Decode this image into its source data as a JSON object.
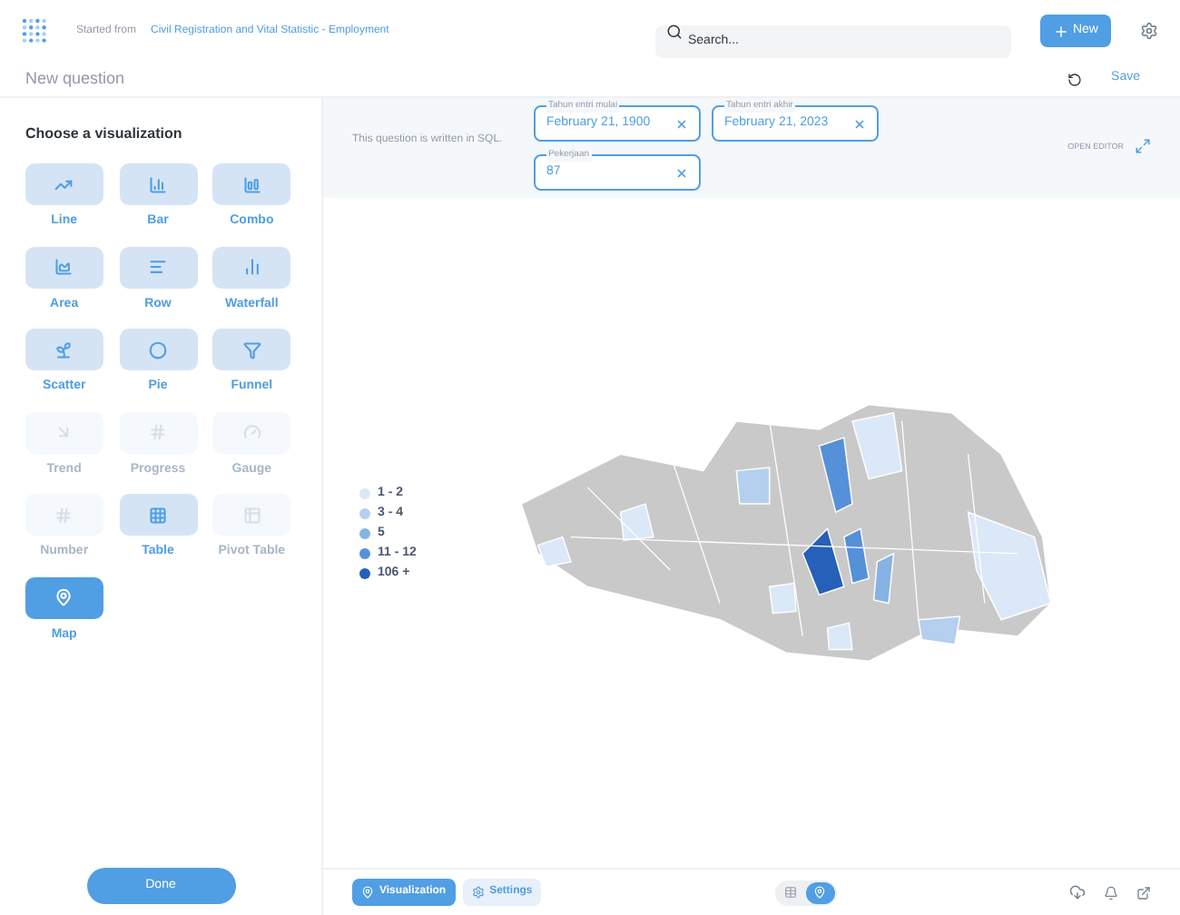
{
  "header": {
    "prefix": "Started from",
    "source": "Civil Registration and Vital Statistic - Employment",
    "search_placeholder": "Search...",
    "new_button": "New"
  },
  "question": {
    "title": "New question",
    "save": "Save"
  },
  "sidebar": {
    "title": "Choose a visualization",
    "done": "Done",
    "items": [
      {
        "kind": "line",
        "label": "Line",
        "selected": false,
        "disabled": false
      },
      {
        "kind": "bar",
        "label": "Bar",
        "selected": false,
        "disabled": false
      },
      {
        "kind": "combo",
        "label": "Combo",
        "selected": false,
        "disabled": false
      },
      {
        "kind": "area",
        "label": "Area",
        "selected": false,
        "disabled": false
      },
      {
        "kind": "row",
        "label": "Row",
        "selected": false,
        "disabled": false
      },
      {
        "kind": "waterfall",
        "label": "Waterfall",
        "selected": false,
        "disabled": false
      },
      {
        "kind": "scatter",
        "label": "Scatter",
        "selected": false,
        "disabled": false
      },
      {
        "kind": "pie",
        "label": "Pie",
        "selected": false,
        "disabled": false
      },
      {
        "kind": "funnel",
        "label": "Funnel",
        "selected": false,
        "disabled": false
      },
      {
        "kind": "trend",
        "label": "Trend",
        "selected": false,
        "disabled": true
      },
      {
        "kind": "progress",
        "label": "Progress",
        "selected": false,
        "disabled": true
      },
      {
        "kind": "gauge",
        "label": "Gauge",
        "selected": false,
        "disabled": true
      },
      {
        "kind": "number",
        "label": "Number",
        "selected": false,
        "disabled": true
      },
      {
        "kind": "table",
        "label": "Table",
        "selected": false,
        "disabled": false
      },
      {
        "kind": "pivot",
        "label": "Pivot Table",
        "selected": false,
        "disabled": true
      },
      {
        "kind": "map",
        "label": "Map",
        "selected": true,
        "disabled": false
      }
    ]
  },
  "filters": {
    "note": "This question is written in SQL.",
    "open_editor": "OPEN EDITOR",
    "items": [
      {
        "label": "Tahun entri mulai",
        "value": "February 21, 1900"
      },
      {
        "label": "Tahun entri akhir",
        "value": "February 21, 2023"
      },
      {
        "label": "Pekerjaan",
        "value": "87"
      }
    ]
  },
  "legend": [
    {
      "label": "1 - 2",
      "color": "#dbe8f7"
    },
    {
      "label": "3 - 4",
      "color": "#b4d0ee"
    },
    {
      "label": "5",
      "color": "#86b3e3"
    },
    {
      "label": "11 - 12",
      "color": "#5591d8"
    },
    {
      "label": "106 +",
      "color": "#2660b8"
    }
  ],
  "footer": {
    "visualization": "Visualization",
    "settings": "Settings",
    "view": [
      {
        "kind": "table",
        "selected": false
      },
      {
        "kind": "map",
        "selected": true
      }
    ]
  }
}
